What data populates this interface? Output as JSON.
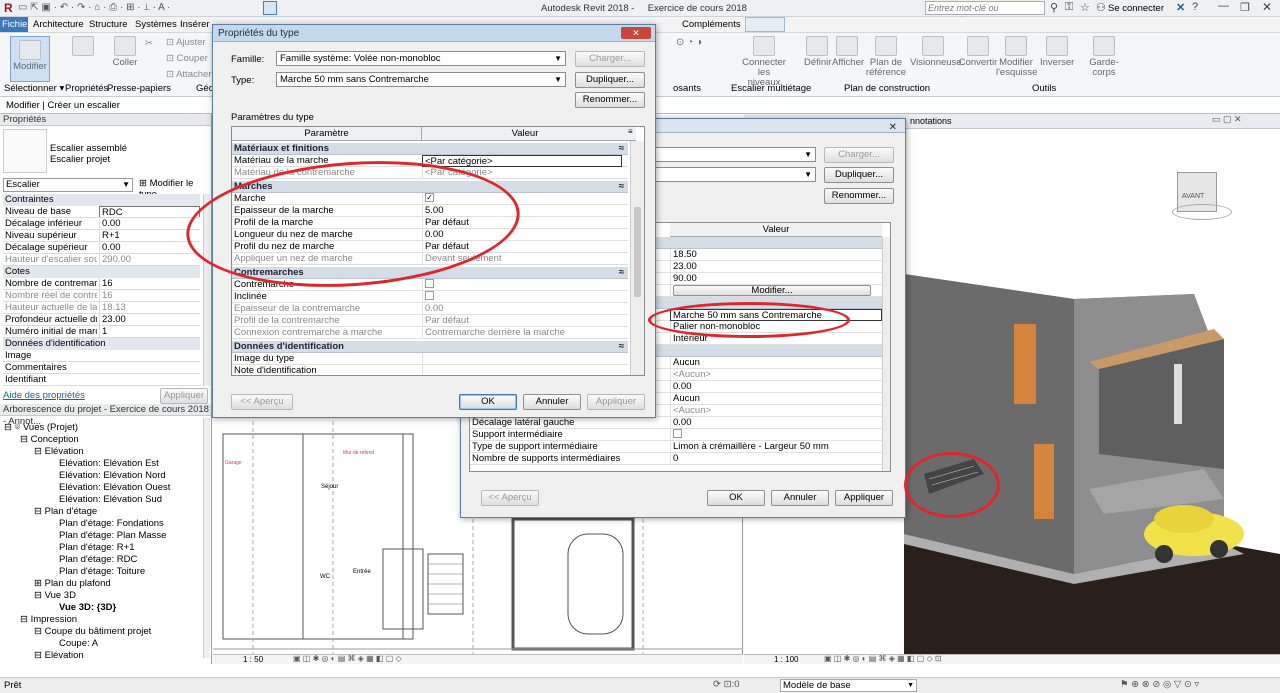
{
  "app": {
    "title": "Autodesk Revit 2018 -",
    "file": "Exercice de cours 2018",
    "search_placeholder": "Entrez mot-clé ou expression",
    "signin": "Se connecter"
  },
  "menu": [
    "Fichier",
    "Architecture",
    "Structure",
    "Systèmes",
    "Insérer"
  ],
  "menu_right": "Compléments",
  "ribbon": {
    "modify": "Modifier",
    "select": "Sélectionner ▾",
    "props": "Propriétés",
    "clipboard": "Presse-papiers",
    "geo": "Géo",
    "paste": "Coller",
    "adjust": "Ajuster",
    "cut": "Couper",
    "attach": "Attacher",
    "connect": "Connecter les niveaux",
    "define": "Définir",
    "display": "Afficher",
    "plan_ref": "Plan de référence",
    "viewer": "Visionneuse",
    "convert": "Convertir",
    "edit_sketch": "Modifier l'esquisse",
    "invert": "Inverser",
    "railing": "Garde-corps",
    "g_components": "osants",
    "g_multistair": "Escalier multiétage",
    "g_workplane": "Plan de construction",
    "g_tools": "Outils"
  },
  "optbar": "Modifier | Créer un escalier",
  "properties": {
    "title": "Propriétés",
    "type_line1": "Escalier assemblé",
    "type_line2": "Escalier projet",
    "selector": "Escalier",
    "edit_type": "Modifier le type",
    "help": "Aide des propriétés",
    "apply": "Appliquer",
    "sections": {
      "constraints": "Contraintes",
      "dims": "Cotes",
      "ident": "Données d'identification"
    },
    "rows": [
      {
        "k": "Niveau de base",
        "v": "RDC"
      },
      {
        "k": "Décalage inférieur",
        "v": "0.00"
      },
      {
        "k": "Niveau supérieur",
        "v": "R+1"
      },
      {
        "k": "Décalage supérieur",
        "v": "0.00"
      },
      {
        "k": "Hauteur d'escalier souh...",
        "v": "290.00"
      },
      {
        "k": "Nombre de contremarc...",
        "v": "16"
      },
      {
        "k": "Nombre réel de contre...",
        "v": "16"
      },
      {
        "k": "Hauteur actuelle de la ...",
        "v": "18.13"
      },
      {
        "k": "Profondeur actuelle du ...",
        "v": "23.00"
      },
      {
        "k": "Numéro initial de marc...",
        "v": "1"
      },
      {
        "k": "Image",
        "v": ""
      },
      {
        "k": "Commentaires",
        "v": ""
      },
      {
        "k": "Identifiant",
        "v": ""
      }
    ]
  },
  "browser": {
    "title": "Arborescence du projet - Exercice de cours 2018 - Annot...",
    "items": [
      "Vues (Projet)",
      "Conception",
      "Elévation",
      "Elévation: Elévation Est",
      "Elévation: Elévation Nord",
      "Elévation: Elévation Ouest",
      "Elévation: Elévation Sud",
      "Plan d'étage",
      "Plan d'étage: Fondations",
      "Plan d'étage: Plan Masse",
      "Plan d'étage: R+1",
      "Plan d'étage: RDC",
      "Plan d'étage: Toiture",
      "Plan du plafond",
      "Vue 3D",
      "Vue 3D: {3D}",
      "Impression",
      "Coupe du bâtiment projet",
      "Coupe: A",
      "Elévation"
    ]
  },
  "plan": {
    "scale": "1 : 50",
    "rooms": [
      "Séjour",
      "Entrée",
      "WC"
    ]
  },
  "view3d": {
    "title": "nnotations",
    "scale": "1 : 100",
    "cube": "AVANT"
  },
  "status": {
    "ready": "Prêt",
    "model": "Modèle de base",
    "zero": ":0"
  },
  "dialog1": {
    "title": "Propriétés du type",
    "family_lbl": "Famille:",
    "family": "Famille système: Volée non-monobloc",
    "type_lbl": "Type:",
    "type": "Marche 50 mm sans Contremarche",
    "load": "Charger...",
    "duplicate": "Dupliquer...",
    "rename": "Renommer...",
    "params": "Paramètres du type",
    "col_param": "Paramètre",
    "col_value": "Valeur",
    "s1": "Matériaux et finitions",
    "s2": "Marches",
    "s3": "Contremarches",
    "s4": "Données d'identification",
    "r": [
      [
        "Matériau de la marche",
        "<Par catégorie>"
      ],
      [
        "Matériau de la contremarche",
        "<Par catégorie>"
      ],
      [
        "Marche",
        ""
      ],
      [
        "Epaisseur de la marche",
        "5.00"
      ],
      [
        "Profil de la marche",
        "Par défaut"
      ],
      [
        "Longueur du nez de marche",
        "0.00"
      ],
      [
        "Profil du nez de marche",
        "Par défaut"
      ],
      [
        "Appliquer un nez de marche",
        "Devant seulement"
      ],
      [
        "Contremarche",
        ""
      ],
      [
        "Inclinée",
        ""
      ],
      [
        "Epaisseur de la contremarche",
        "0.00"
      ],
      [
        "Profil de la contremarche",
        "Par défaut"
      ],
      [
        "Connexion contremarche à marche",
        "Contremarche derrière la marche"
      ],
      [
        "Image du type",
        ""
      ],
      [
        "Note d'identification",
        ""
      ]
    ],
    "preview": "<< Aperçu",
    "ok": "OK",
    "cancel": "Annuler",
    "apply": "Appliquer"
  },
  "dialog2": {
    "load": "Charger...",
    "duplicate": "Dupliquer...",
    "rename": "Renommer...",
    "col_value": "Valeur",
    "modify": "Modifier...",
    "v": [
      "18.50",
      "23.00",
      "90.00",
      "Marche 50 mm sans Contremarche",
      "Palier non-monobloc",
      "Intérieur",
      "Aucun",
      "<Aucun>",
      "0.00",
      "Aucun",
      "<Aucun>"
    ],
    "rows": [
      [
        "Décalage latéral gauche",
        "0.00"
      ],
      [
        "Support intermédiaire",
        ""
      ],
      [
        "Type de support intermédiaire",
        "Limon à crémaillère - Largeur 50 mm"
      ],
      [
        "Nombre de supports intermédiaires",
        "0"
      ]
    ],
    "preview": "<< Aperçu",
    "ok": "OK",
    "cancel": "Annuler",
    "apply": "Appliquer"
  },
  "colors": {
    "accent": "#e0262b",
    "title": "#c5d7ea",
    "section": "#d4dce6"
  }
}
